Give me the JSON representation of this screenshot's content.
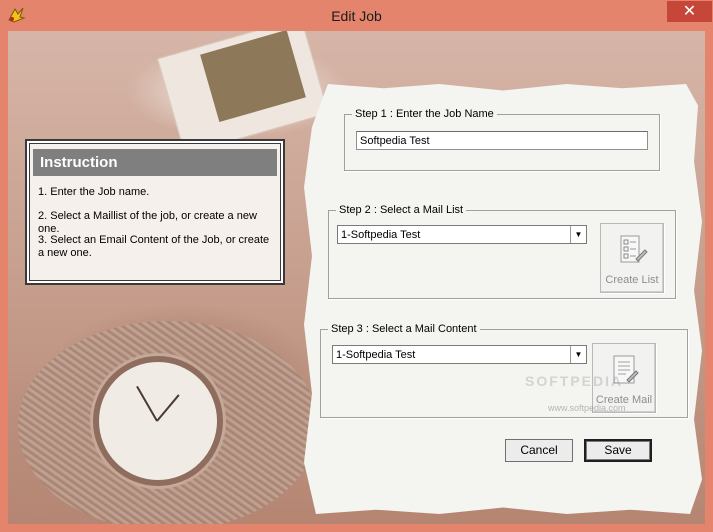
{
  "window": {
    "title": "Edit Job",
    "close_glyph": "✕"
  },
  "instruction": {
    "heading": "Instruction",
    "lines": [
      "1. Enter the Job name.",
      "2. Select a Maillist of the job, or create a new one.",
      "3. Select an Email Content of the Job, or create a new one."
    ]
  },
  "step1": {
    "legend": "Step 1 : Enter the Job Name",
    "value": "Softpedia Test"
  },
  "step2": {
    "legend": "Step  2 : Select a Mail List",
    "selected": "1-Softpedia Test",
    "button_label": "Create List",
    "button_icon": "create-list-icon"
  },
  "step3": {
    "legend": "Step 3 : Select a Mail Content",
    "selected": "1-Softpedia Test",
    "button_label": "Create Mail",
    "button_icon": "create-mail-icon"
  },
  "footer": {
    "cancel_label": "Cancel",
    "save_label": "Save"
  },
  "watermark": {
    "brand": "SOFTPEDIA",
    "url": "www.softpedia.com"
  },
  "colors": {
    "titlebar": "#e4846c",
    "close": "#c7463a",
    "paper": "#f4f4f1",
    "instruction_head": "#7f7f7f"
  }
}
